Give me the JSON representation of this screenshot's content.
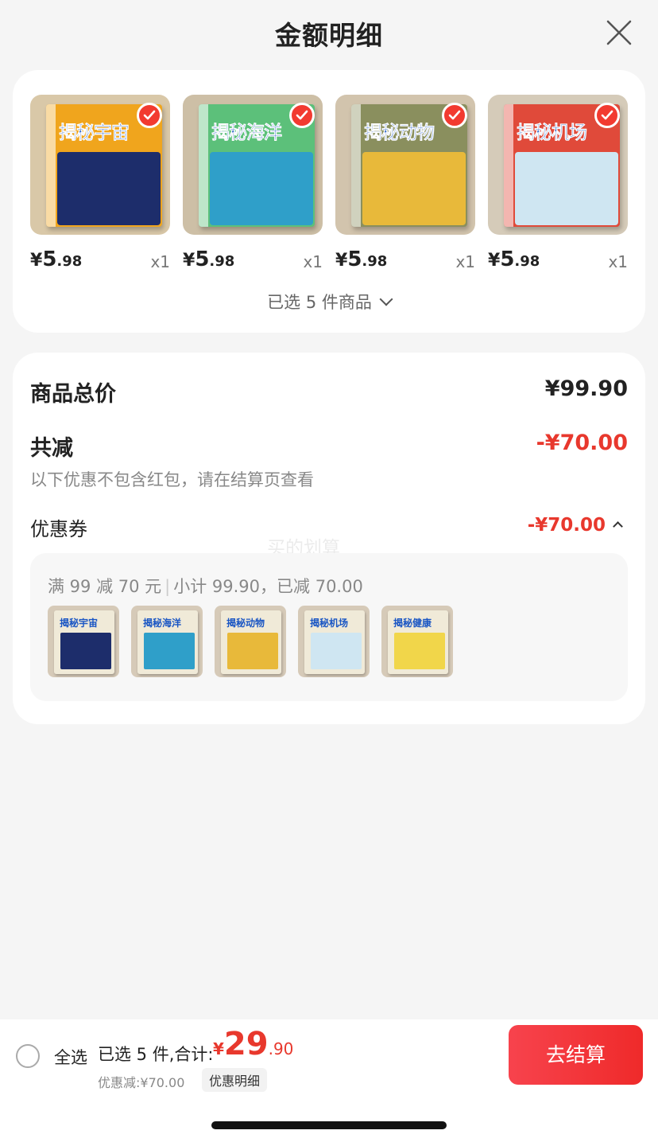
{
  "header": {
    "title": "金额明细"
  },
  "products": [
    {
      "cover_title": "揭秘宇宙",
      "price_yen": "¥",
      "price_int": "5",
      "price_dec": ".98",
      "qty": "x1",
      "bg": "#d9c8a8",
      "scene": "#1d2d6b",
      "accent": "#f0a51d"
    },
    {
      "cover_title": "揭秘海洋",
      "price_yen": "¥",
      "price_int": "5",
      "price_dec": ".98",
      "qty": "x1",
      "bg": "#cdbfa6",
      "scene": "#2f9fc9",
      "accent": "#5cc07a"
    },
    {
      "cover_title": "揭秘动物",
      "price_yen": "¥",
      "price_int": "5",
      "price_dec": ".98",
      "qty": "x1",
      "bg": "#d2c4ad",
      "scene": "#e8b93a",
      "accent": "#8a8f5e"
    },
    {
      "cover_title": "揭秘机场",
      "price_yen": "¥",
      "price_int": "5",
      "price_dec": ".98",
      "qty": "x1",
      "bg": "#d5cbb9",
      "scene": "#cfe6f2",
      "accent": "#e04a3a"
    }
  ],
  "selected_count_label": "已选 5 件商品",
  "breakdown": {
    "total_label": "商品总价",
    "total_value": "¥99.90",
    "reduce_label": "共减",
    "reduce_value": "-¥70.00",
    "note": "以下优惠不包含红包，请在结算页查看",
    "coupon_label": "优惠券",
    "coupon_value": "-¥70.00",
    "watermark": "买的划算",
    "coupon_rule_a": "满 99 减 70 元",
    "coupon_rule_sep": "|",
    "coupon_rule_b": "小计 99.90，已减 70.00",
    "thumbs": [
      {
        "title": "揭秘宇宙",
        "scene": "#1d2d6b"
      },
      {
        "title": "揭秘海洋",
        "scene": "#2f9fc9"
      },
      {
        "title": "揭秘动物",
        "scene": "#e8b93a"
      },
      {
        "title": "揭秘机场",
        "scene": "#cfe6f2"
      },
      {
        "title": "揭秘健康",
        "scene": "#f1d64a"
      }
    ]
  },
  "bottom": {
    "select_all": "全选",
    "summary": "已选 5 件,合计:",
    "total_yen": "¥",
    "total_int": "29",
    "total_dec": ".90",
    "discount": "优惠减:¥70.00",
    "detail_chip": "优惠明细",
    "checkout": "去结算"
  },
  "colors": {
    "accent_red": "#e8382d",
    "check_red": "#f23a30",
    "checkout_red": "#ef2a2a"
  }
}
